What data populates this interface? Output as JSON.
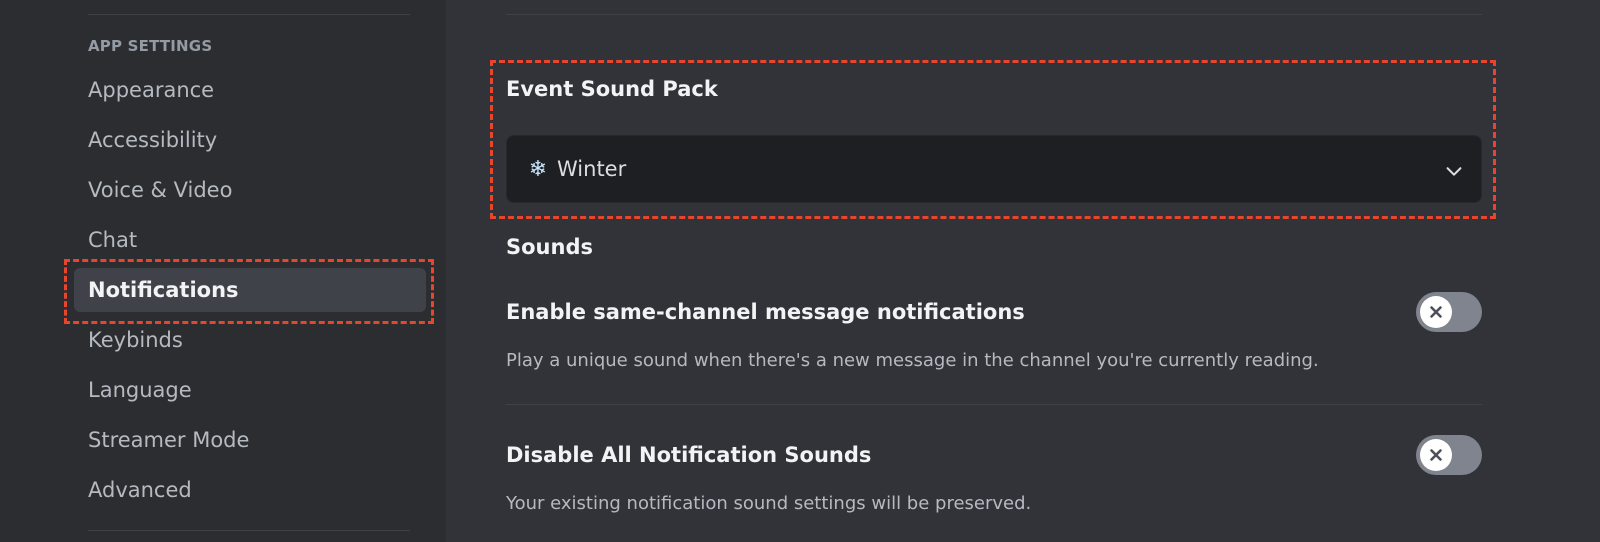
{
  "sidebar": {
    "section_header": "APP SETTINGS",
    "items": [
      {
        "label": "Appearance"
      },
      {
        "label": "Accessibility"
      },
      {
        "label": "Voice & Video"
      },
      {
        "label": "Chat"
      },
      {
        "label": "Notifications",
        "selected": true
      },
      {
        "label": "Keybinds"
      },
      {
        "label": "Language"
      },
      {
        "label": "Streamer Mode"
      },
      {
        "label": "Advanced"
      }
    ]
  },
  "main": {
    "event_sound_pack": {
      "title": "Event Sound Pack",
      "selected_icon": "snowflake-icon",
      "selected_value": "Winter"
    },
    "sounds_title": "Sounds",
    "settings": [
      {
        "title": "Enable same-channel message notifications",
        "description": "Play a unique sound when there's a new message in the channel you're currently reading.",
        "enabled": false
      },
      {
        "title": "Disable All Notification Sounds",
        "description": "Your existing notification sound settings will be preserved.",
        "enabled": false
      }
    ]
  },
  "colors": {
    "highlight": "#e8452c",
    "sidebar_bg": "#2b2d31",
    "content_bg": "#313338",
    "toggle_off": "#80848e"
  }
}
